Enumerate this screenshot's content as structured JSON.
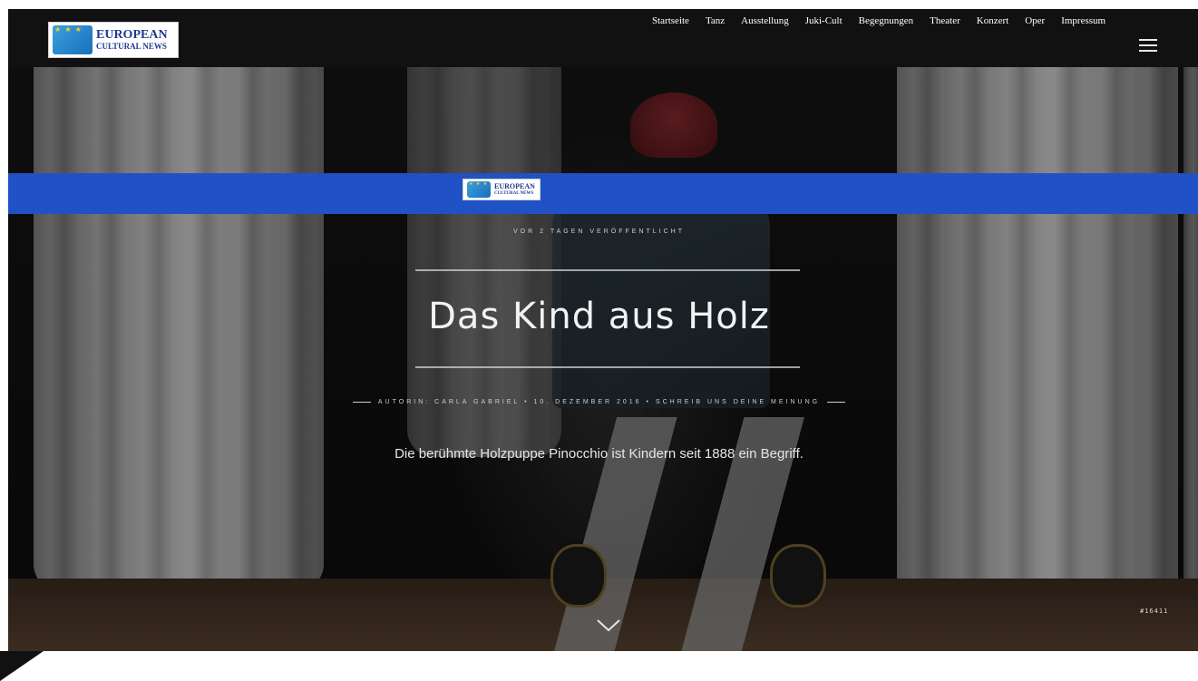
{
  "header": {
    "logo": {
      "line1": "EUROPEAN",
      "line2": "CULTURAL NEWS"
    },
    "menu_icon": "hamburger-menu-icon"
  },
  "nav": {
    "logo": {
      "line1": "EUROPEAN",
      "line2": "CULTURAL NEWS"
    },
    "items": [
      {
        "label": "Startseite"
      },
      {
        "label": "Tanz"
      },
      {
        "label": "Ausstellung"
      },
      {
        "label": "Juki-Cult"
      },
      {
        "label": "Begegnungen"
      },
      {
        "label": "Theater"
      },
      {
        "label": "Konzert"
      },
      {
        "label": "Oper"
      },
      {
        "label": "Impressum"
      }
    ],
    "background": "#2052c6"
  },
  "hero": {
    "published": "VOR 2 TAGEN VERÖFFENTLICHT",
    "title": "Das Kind aus Holz",
    "byline": {
      "author": "AUTORIN: CARLA GABRIEL",
      "separator": "•",
      "date": "10. DEZEMBER 2016",
      "comment_link": "SCHREIB UNS DEINE MEINUNG"
    },
    "excerpt": "Die berühmte Holzpuppe Pinocchio ist Kindern seit 1888 ein Begriff.",
    "photo_id": "#16411",
    "scroll_icon": "chevron-down-icon"
  }
}
